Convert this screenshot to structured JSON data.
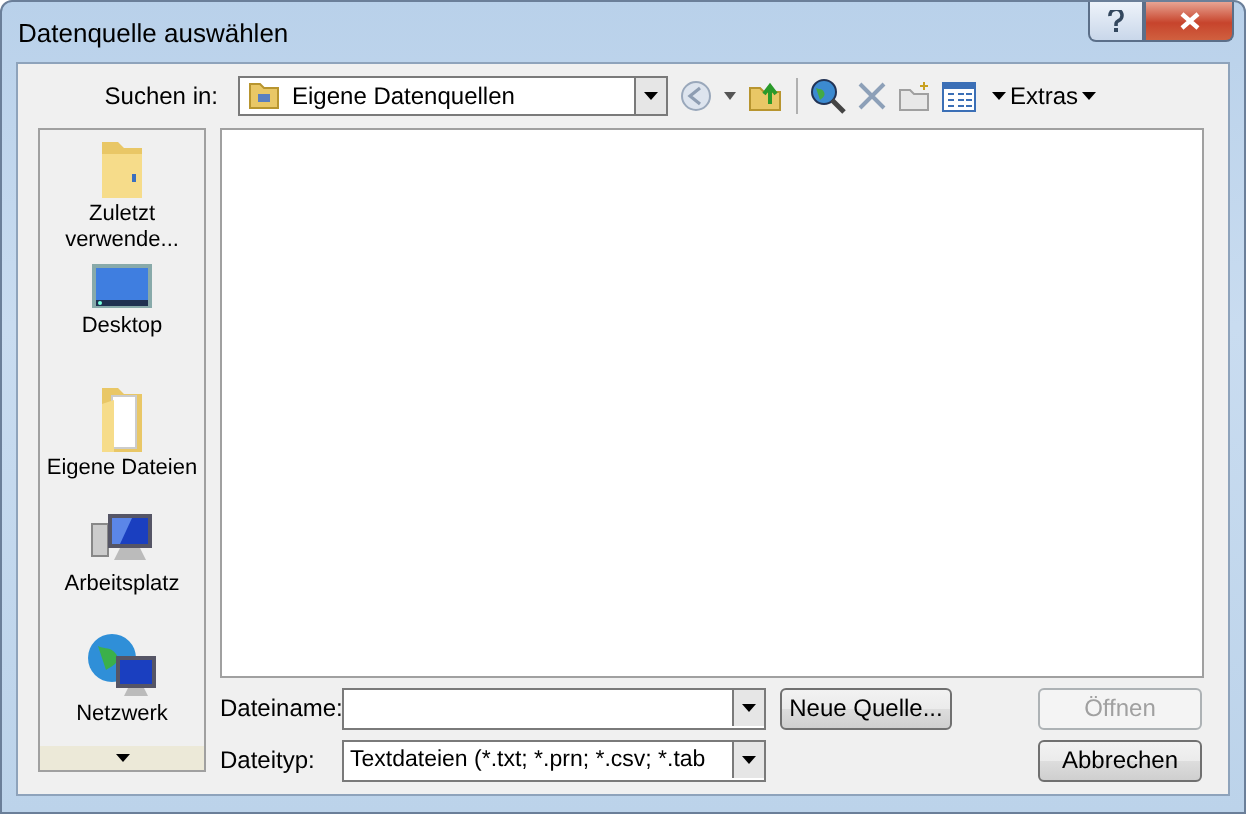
{
  "window": {
    "title": "Datenquelle auswählen"
  },
  "toolbar": {
    "look_in_label": "Suchen in:",
    "location": "Eigene Datenquellen",
    "extras": "Extras"
  },
  "sidebar": {
    "items": [
      {
        "label": "Zuletzt verwende...",
        "kind": "recent"
      },
      {
        "label": "Desktop",
        "kind": "desktop"
      },
      {
        "label": "Eigene Dateien",
        "kind": "documents"
      },
      {
        "label": "Arbeitsplatz",
        "kind": "computer"
      },
      {
        "label": "Netzwerk",
        "kind": "network"
      }
    ]
  },
  "file_name": {
    "label": "Dateiname:"
  },
  "file_type": {
    "label": "Dateityp:",
    "value": "Textdateien (*.txt; *.prn; *.csv; *.tab"
  },
  "new_source_button": {
    "label": "Neue Quelle...",
    "disabled": false
  },
  "open_button": {
    "label": "Öffnen",
    "disabled": true
  },
  "cancel_button": {
    "label": "Abbrechen",
    "disabled": false
  }
}
